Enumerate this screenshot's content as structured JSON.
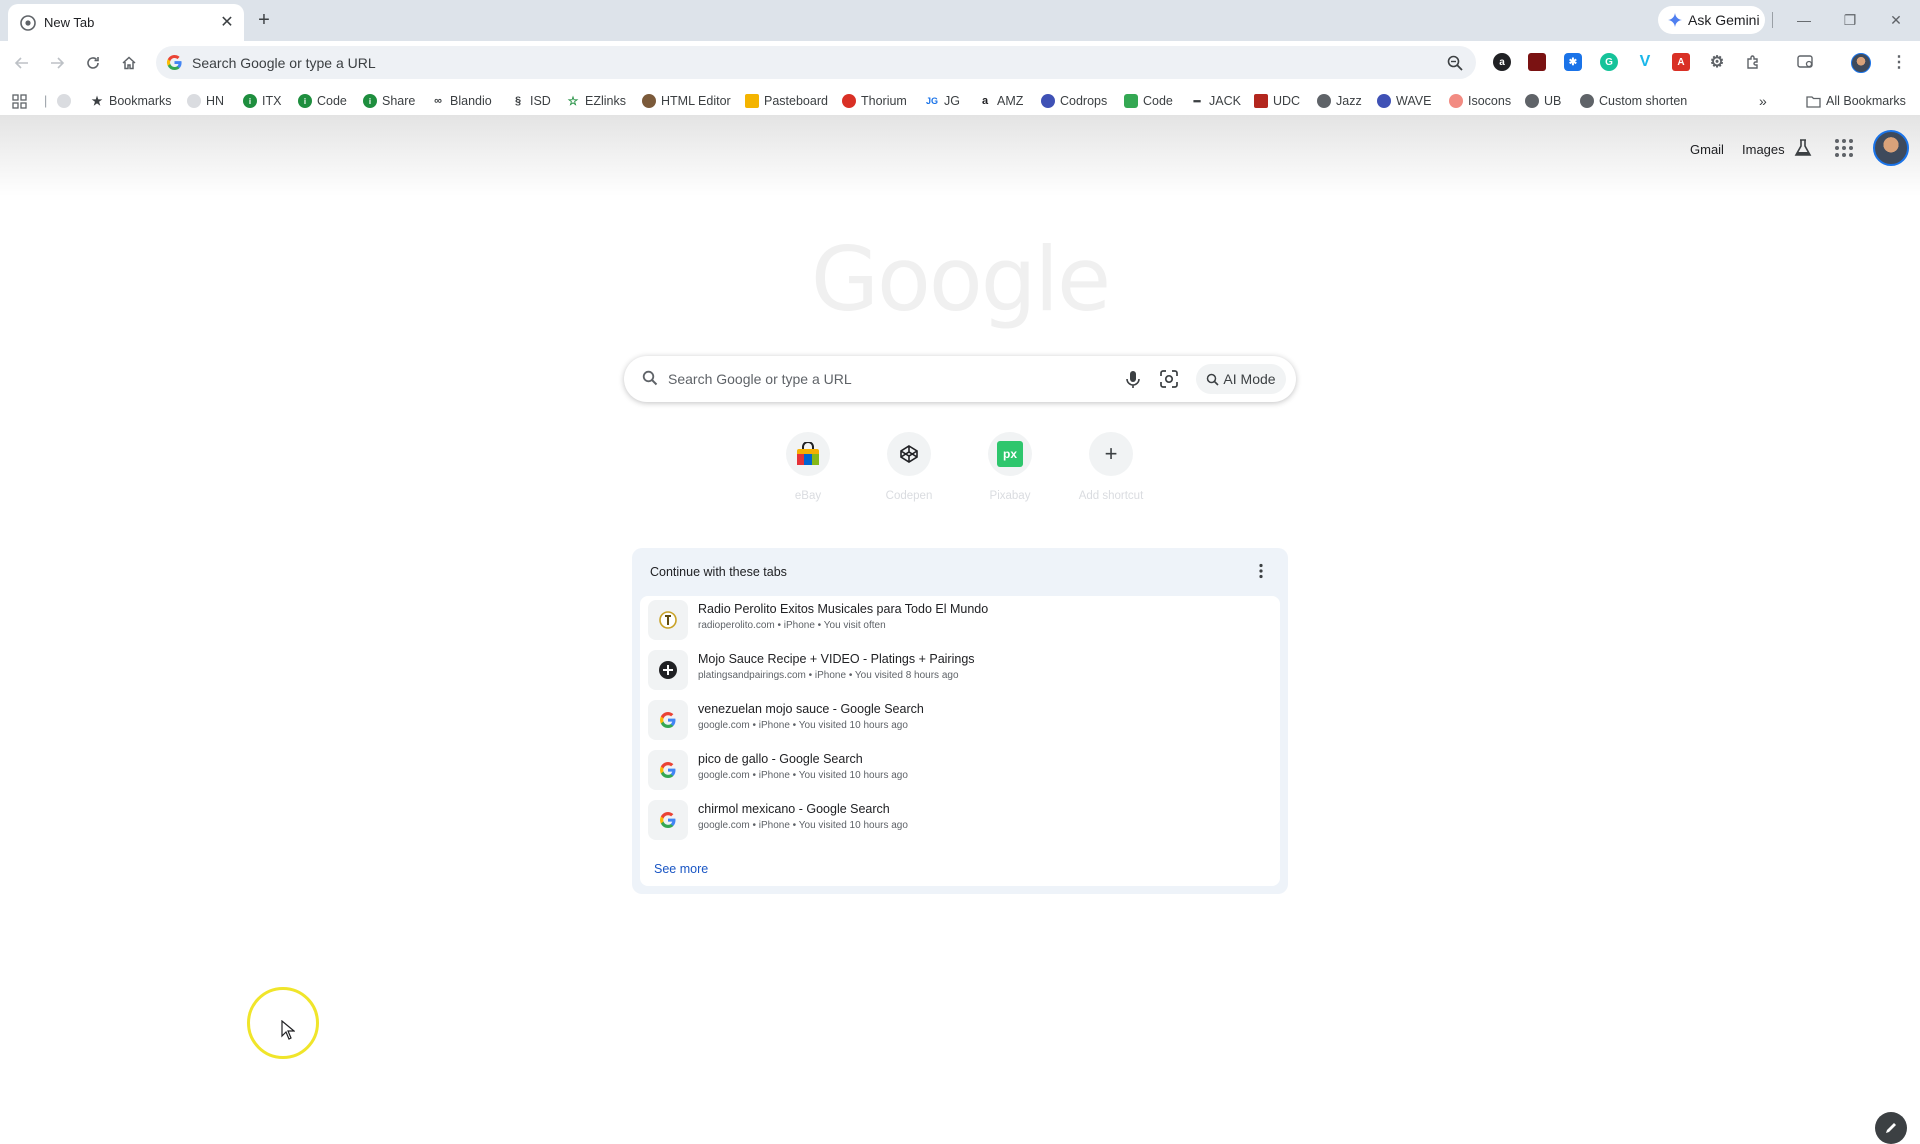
{
  "tab": {
    "title": "New Tab"
  },
  "gemini": {
    "label": "Ask Gemini"
  },
  "omnibox": {
    "placeholder": "Search Google or type a URL"
  },
  "bookmarks": [
    {
      "label": "Bookmarks"
    },
    {
      "label": "HN"
    },
    {
      "label": "ITX"
    },
    {
      "label": "Code"
    },
    {
      "label": "Share"
    },
    {
      "label": "Blandio"
    },
    {
      "label": "ISD"
    },
    {
      "label": "EZlinks"
    },
    {
      "label": "HTML Editor"
    },
    {
      "label": "Pasteboard"
    },
    {
      "label": "Thorium"
    },
    {
      "label": "JG"
    },
    {
      "label": "AMZ"
    },
    {
      "label": "Codrops"
    },
    {
      "label": "Code"
    },
    {
      "label": "JACK"
    },
    {
      "label": "UDC"
    },
    {
      "label": "Jazz"
    },
    {
      "label": "WAVE"
    },
    {
      "label": "Isocons"
    },
    {
      "label": "UB"
    },
    {
      "label": "Custom shorten"
    }
  ],
  "all_bookmarks": "All Bookmarks",
  "header_links": {
    "gmail": "Gmail",
    "images": "Images"
  },
  "search": {
    "placeholder": "Search Google or type a URL",
    "ai_mode": "AI Mode"
  },
  "shortcuts": [
    {
      "label": "eBay"
    },
    {
      "label": "Codepen"
    },
    {
      "label": "Pixabay"
    },
    {
      "label": "Add shortcut"
    }
  ],
  "continue_card": {
    "title": "Continue with these tabs",
    "items": [
      {
        "title": "Radio Perolito Exitos Musicales para Todo El Mundo",
        "sub": "radioperolito.com • iPhone • You visit often"
      },
      {
        "title": "Mojo Sauce Recipe + VIDEO - Platings + Pairings",
        "sub": "platingsandpairings.com • iPhone • You visited 8 hours ago"
      },
      {
        "title": "venezuelan mojo sauce - Google Search",
        "sub": "google.com • iPhone • You visited 10 hours ago"
      },
      {
        "title": "pico de gallo - Google Search",
        "sub": "google.com • iPhone • You visited 10 hours ago"
      },
      {
        "title": "chirmol mexicano - Google Search",
        "sub": "google.com • iPhone • You visited 10 hours ago"
      }
    ],
    "see_more": "See more"
  },
  "colors": {
    "tabstrip": "#dde3ea",
    "link": "#1a56c4",
    "cursor_ring": "#f0e52a"
  }
}
